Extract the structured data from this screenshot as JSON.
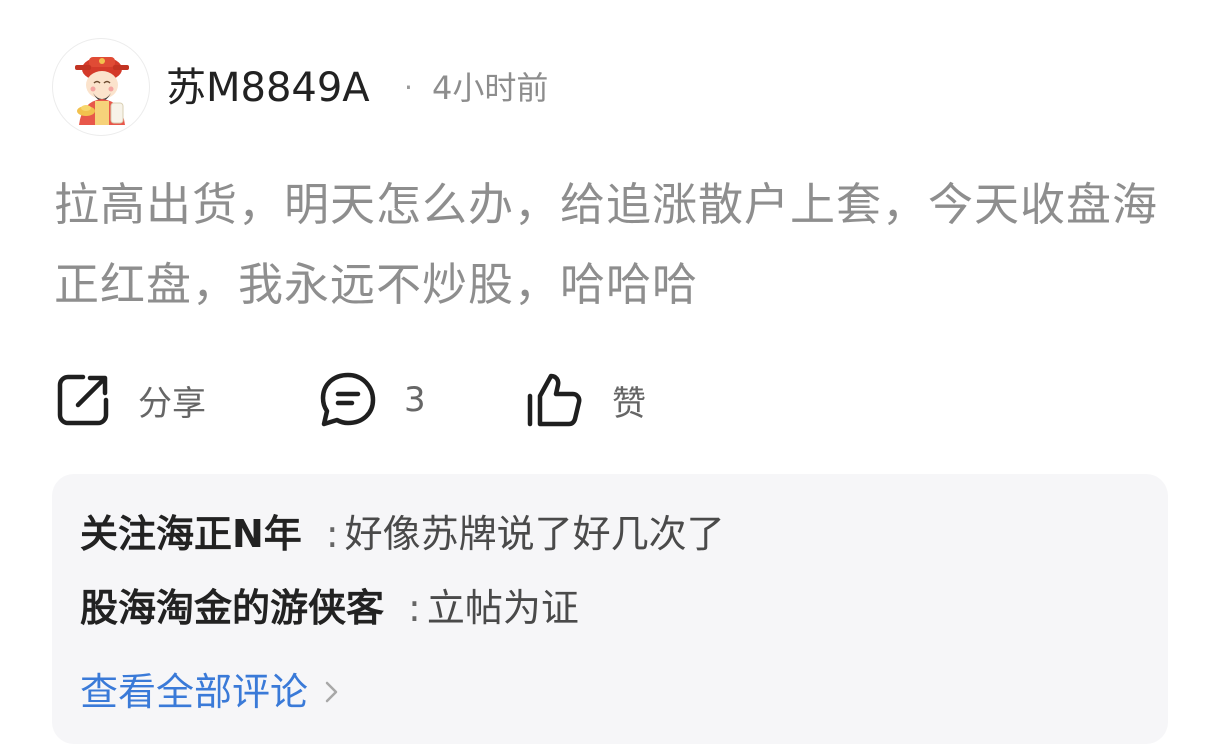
{
  "post": {
    "author": "苏M8849A",
    "separator": "·",
    "time": "4小时前",
    "content": "拉高出货，明天怎么办，给追涨散户上套，今天收盘海正红盘，我永远不炒股，哈哈哈"
  },
  "actions": {
    "share_label": "分享",
    "comment_count": "3",
    "like_label": "赞",
    "share_icon": "share-icon",
    "comment_icon": "comment-icon",
    "like_icon": "thumbs-up-icon"
  },
  "comments": [
    {
      "user": "关注海正N年",
      "sep": ":",
      "text": "好像苏牌说了好几次了"
    },
    {
      "user": "股海淘金的游侠客",
      "sep": ":",
      "text": "立帖为证"
    }
  ],
  "view_all_label": "查看全部评论",
  "colors": {
    "link": "#3a7ad8",
    "content_text": "#8e8e8e",
    "comment_bg": "#f6f6f8"
  }
}
